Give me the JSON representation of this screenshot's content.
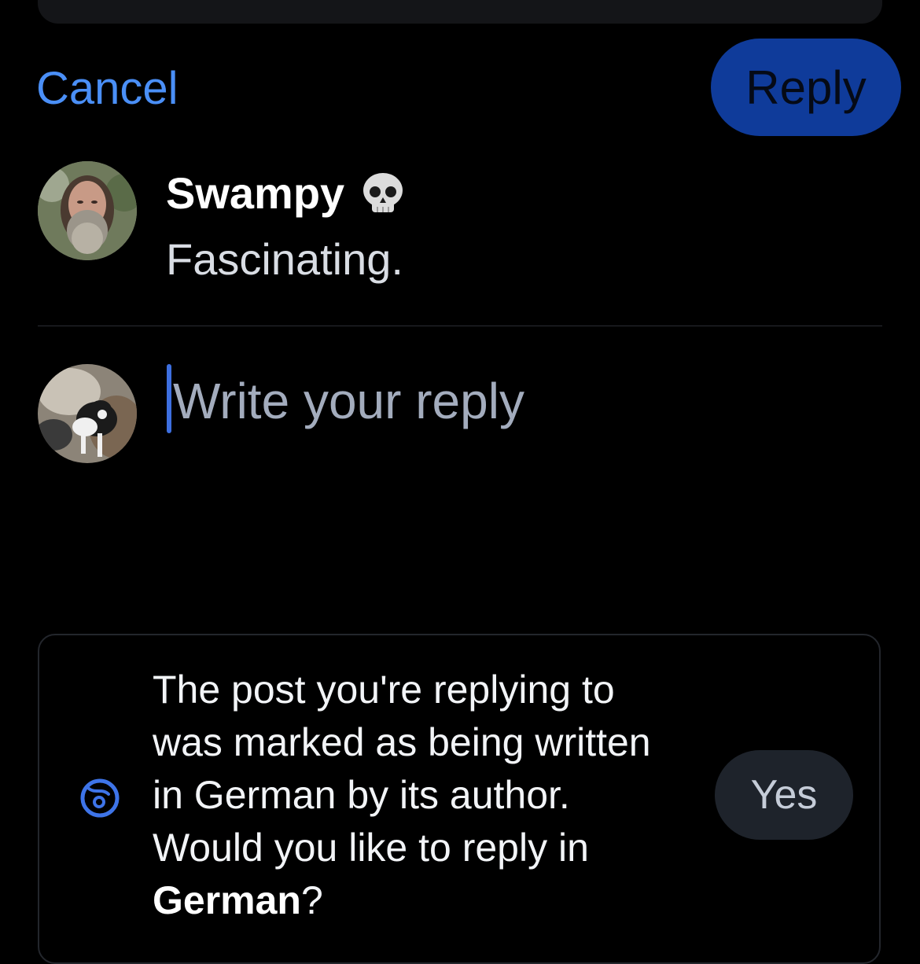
{
  "header": {
    "cancel_label": "Cancel",
    "reply_label": "Reply"
  },
  "original_post": {
    "author_name": "Swampy",
    "author_emoji": "skull-icon",
    "text": "Fascinating."
  },
  "composer": {
    "placeholder": "Write your reply",
    "value": ""
  },
  "language_prompt": {
    "icon": "language-globe-icon",
    "text_prefix": "The post you're replying to was marked as being written in German by its author. Would you like to reply in ",
    "language": "German",
    "text_suffix": "?",
    "yes_label": "Yes"
  },
  "colors": {
    "accent": "#4a8ff7",
    "reply_button_bg": "#0f3b9a",
    "background": "#000000",
    "placeholder": "#a3acbd"
  }
}
